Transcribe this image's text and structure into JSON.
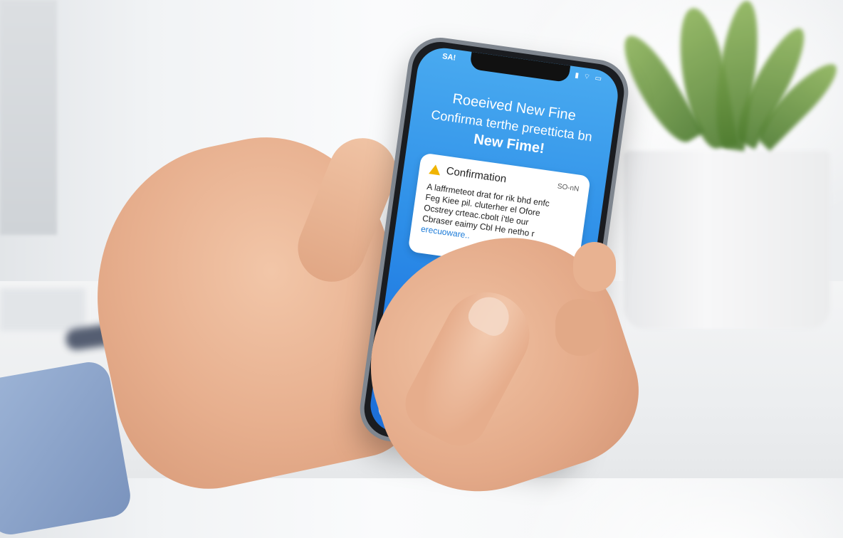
{
  "status": {
    "time": "SA!",
    "icons": "▮ ⌔ ▭"
  },
  "hero": {
    "title": "Roeeived New Fine",
    "subtitle": "Confirma terthe preetticta bn",
    "emphasis": "New Fime!"
  },
  "notification": {
    "icon": "warning-triangle-icon",
    "title": "Confirmation",
    "time": "SO-nN",
    "body_lines": [
      "A laffrmeteot drat for rik bhd enfc",
      "Feg Kiee pil. cluterher el Ofore",
      "Ocstrey crteac.cbolt í'tle our",
      "Cbraser eaimy Cbl He netho r"
    ],
    "link": "erecuoware.."
  },
  "bottom": {
    "icon": "message-icon"
  },
  "colors": {
    "screen_top": "#49aaf0",
    "screen_bottom": "#1c74e0",
    "warning": "#f0b400",
    "link": "#1a7ad8",
    "message_green": "#35c24a"
  }
}
